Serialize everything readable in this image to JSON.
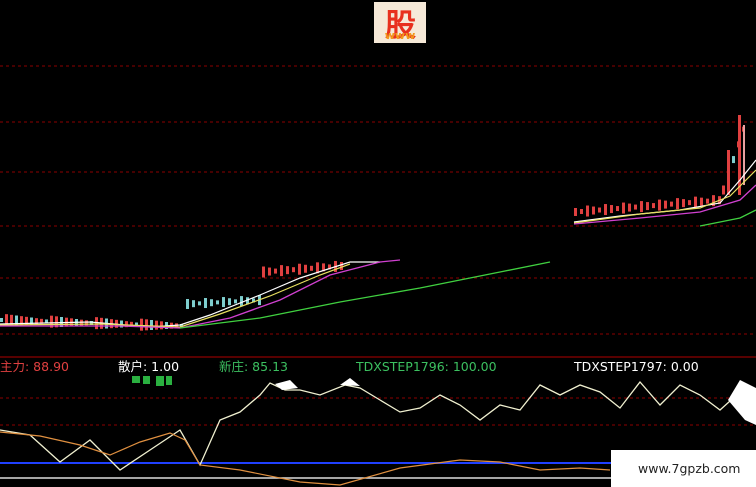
{
  "logo": {
    "text": "股",
    "sub": "www"
  },
  "watermark": "www.7gpzb.com",
  "indicator": {
    "label_main": "主力: 88.90",
    "label_retail": "散户: 1.00",
    "label_new": "新庄: 85.13",
    "label_step1": "TDXSTEP1796: 100.00",
    "label_step2": "TDXSTEP1797: 0.00",
    "colors": {
      "main": "#e04040",
      "retail": "#ffffff",
      "new": "#3cc060",
      "step1": "#3cc060",
      "step2": "#ffffff"
    }
  },
  "colors": {
    "background": "#000000",
    "grid_red": "#8b0000",
    "candle_up": "#e04040",
    "candle_down": "#7ecece",
    "ma_white": "#ffffff",
    "ma_yellow": "#e8e060",
    "ma_magenta": "#d040d0",
    "ma_green": "#40d040",
    "osc_white": "#f0f0d0",
    "osc_orange": "#e09040",
    "blue_line": "#2040ff"
  }
}
